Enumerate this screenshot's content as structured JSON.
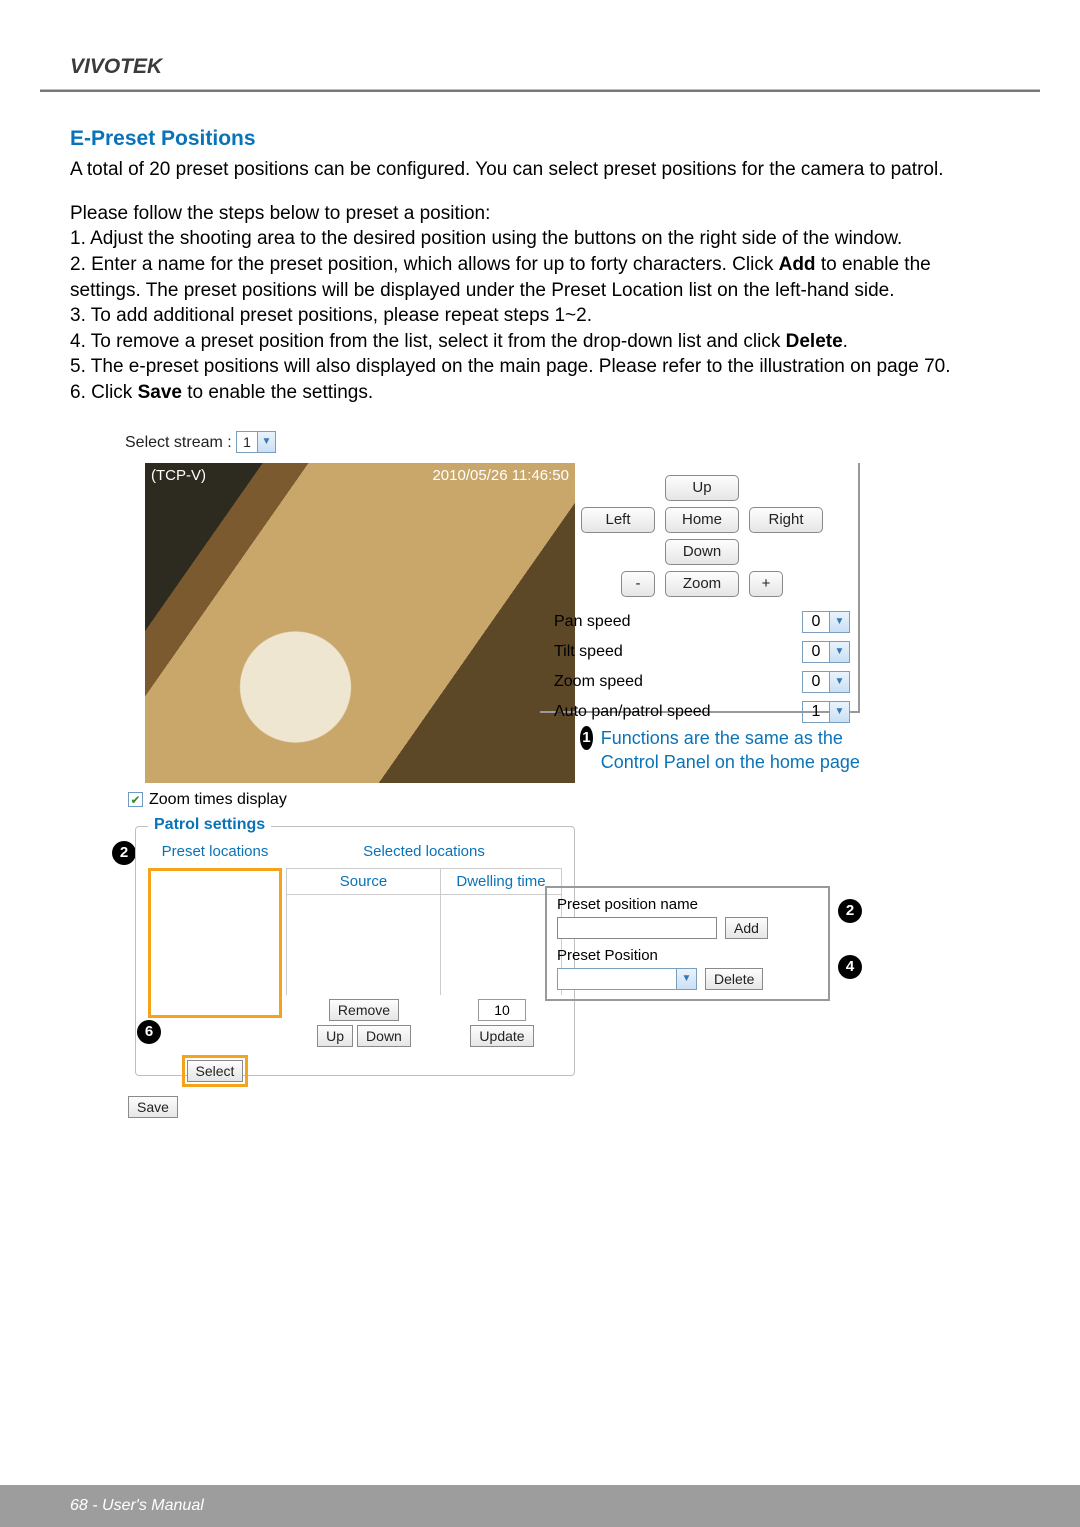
{
  "brand": "VIVOTEK",
  "section_title": "E-Preset Positions",
  "intro": "A total of 20 preset positions can be configured. You can select preset positions for the camera to patrol.",
  "follow_text": "Please follow the steps below to preset a position:",
  "steps": {
    "s1": "1. Adjust the shooting area to the desired position using the buttons on the right side of the window.",
    "s2a": "2. Enter a name for the preset position, which allows for up to forty characters. Click ",
    "s2_bold": "Add",
    "s2b": " to enable the",
    "s2c": "settings. The preset positions will be displayed under the Preset Location list on the left-hand side.",
    "s3": "3. To add additional preset positions, please repeat steps 1~2.",
    "s4a": "4. To remove a preset position from the list, select it from the drop-down list and click ",
    "s4_bold": "Delete",
    "s4b": ".",
    "s5": "5. The e-preset positions will also displayed on the main page. Please refer to the illustration on page 70.",
    "s6a": "6. Click ",
    "s6_bold": "Save",
    "s6b": " to enable the settings."
  },
  "stream": {
    "label": "Select stream :",
    "value": "1"
  },
  "video": {
    "overlay_left": "(TCP-V)",
    "overlay_right": "2010/05/26  11:46:50"
  },
  "zoom_checkbox": "Zoom times display",
  "controls": {
    "up": "Up",
    "down": "Down",
    "left": "Left",
    "right": "Right",
    "home": "Home",
    "zoom": "Zoom",
    "minus": "-",
    "plus": "+",
    "pan_speed": "Pan speed",
    "tilt_speed": "Tilt speed",
    "zoom_speed": "Zoom speed",
    "auto_speed": "Auto pan/patrol speed",
    "pan_val": "0",
    "tilt_val": "0",
    "zoom_val": "0",
    "auto_val": "1"
  },
  "annot_functions": "Functions are the same as the Control Panel on the home page",
  "circles": {
    "c1": "1",
    "c2": "2",
    "c4": "4",
    "c6": "6"
  },
  "patrol": {
    "legend": "Patrol settings",
    "preset_locations": "Preset locations",
    "selected_locations": "Selected locations",
    "source": "Source",
    "dwelling": "Dwelling time",
    "select": "Select",
    "remove": "Remove",
    "up": "Up",
    "down": "Down",
    "dwell_val": "10",
    "update": "Update"
  },
  "preset_box": {
    "name_label": "Preset position name",
    "add": "Add",
    "position_label": "Preset Position",
    "delete": "Delete"
  },
  "save": "Save",
  "footer": "68 - User's Manual"
}
